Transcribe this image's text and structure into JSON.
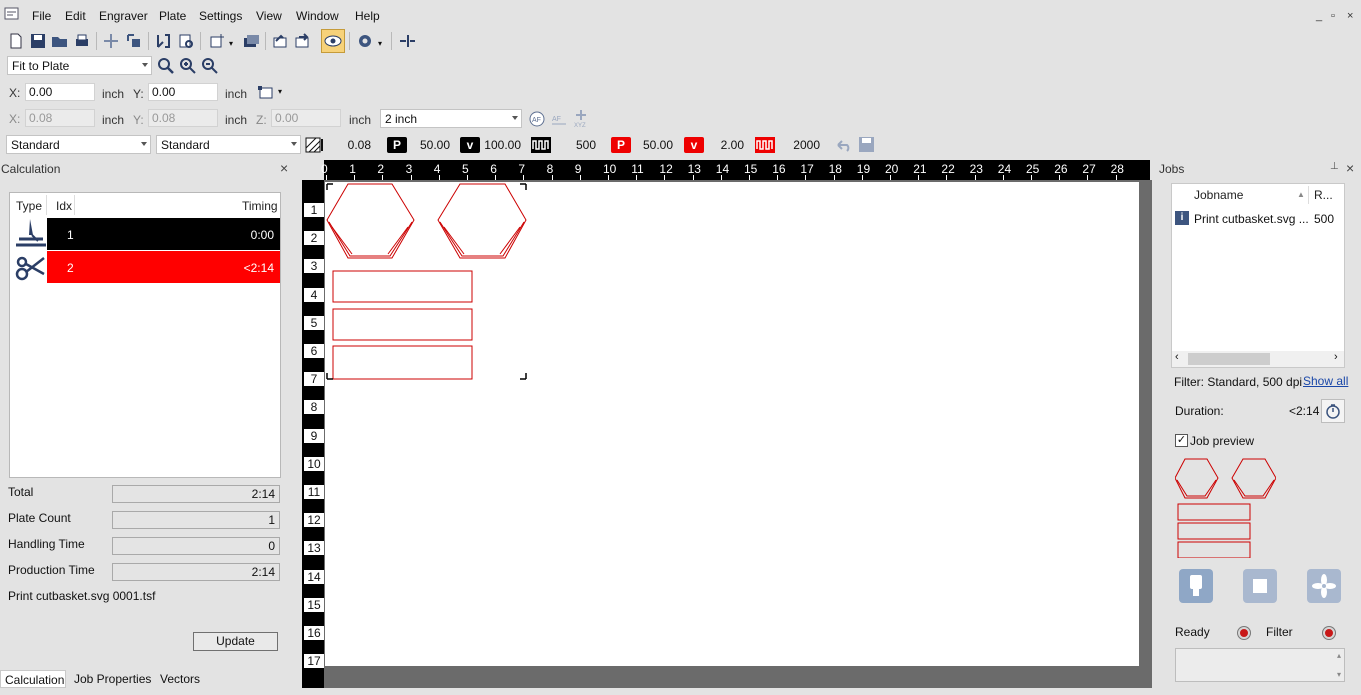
{
  "menu": [
    "File",
    "Edit",
    "Engraver",
    "Plate",
    "Settings",
    "View",
    "Window",
    "Help"
  ],
  "window_controls": [
    "_",
    "▫",
    "×"
  ],
  "view": {
    "zoom_select": "Fit to Plate"
  },
  "position_row1": {
    "x_label": "X:",
    "x_value": "0.00",
    "x_unit": "inch",
    "y_label": "Y:",
    "y_value": "0.00",
    "y_unit": "inch"
  },
  "position_row2": {
    "x_label": "X:",
    "x_value": "0.08",
    "x_unit": "inch",
    "y_label": "Y:",
    "y_value": "0.08",
    "y_unit": "inch",
    "z_label": "Z:",
    "z_value": "0.00",
    "z_unit": "inch",
    "lens_select": "2 inch"
  },
  "parameters": {
    "material_select": "Standard",
    "process_select": "Standard",
    "hatch_value": "0.08",
    "p1_label": "P",
    "p1_value": "50.00",
    "v1_label": "v",
    "v1_value": "100.00",
    "f1_value": "500",
    "p2_label": "P",
    "p2_value": "50.00",
    "v2_label": "v",
    "v2_value": "2.00",
    "f2_value": "2000"
  },
  "calculation": {
    "title": "Calculation",
    "columns": [
      "Type",
      "Idx",
      "Timing"
    ],
    "rows": [
      {
        "idx": "1",
        "timing": "0:00",
        "type_icon": "engrave-icon",
        "color": "#000000"
      },
      {
        "idx": "2",
        "timing": "<2:14",
        "type_icon": "scissors-icon",
        "color": "#ff0000"
      }
    ],
    "total_label": "Total",
    "total_value": "2:14",
    "plate_count_label": "Plate Count",
    "plate_count_value": "1",
    "handling_label": "Handling Time",
    "handling_value": "0",
    "production_label": "Production Time",
    "production_value": "2:14",
    "filename": "Print cutbasket.svg 0001.tsf",
    "update_label": "Update"
  },
  "bottom_tabs": [
    "Calculation",
    "Job Properties",
    "Vectors"
  ],
  "ruler": {
    "top": [
      "0",
      "1",
      "2",
      "3",
      "4",
      "5",
      "6",
      "7",
      "8",
      "9",
      "10",
      "11",
      "12",
      "13",
      "14",
      "15",
      "16",
      "17",
      "18",
      "19",
      "20",
      "21",
      "22",
      "23",
      "24",
      "25",
      "26",
      "27",
      "28"
    ],
    "left": [
      "1",
      "2",
      "3",
      "4",
      "5",
      "6",
      "7",
      "8",
      "9",
      "10",
      "11",
      "12",
      "13",
      "14",
      "15",
      "16",
      "17"
    ]
  },
  "jobs": {
    "title": "Jobs",
    "columns": [
      "Jobname",
      "R..."
    ],
    "rows": [
      {
        "name": "Print cutbasket.svg ...",
        "res": "500"
      }
    ],
    "filter_text": "Filter: Standard, 500 dpi",
    "show_all": "Show all",
    "duration_label": "Duration:",
    "duration_value": "<2:14",
    "job_preview_label": "Job preview",
    "job_preview_checked": true,
    "ready_label": "Ready",
    "filter_label": "Filter"
  },
  "colors": {
    "cut_red": "#cc0000",
    "accent_blue": "#8fa7c6",
    "status_red": "#c81818"
  }
}
